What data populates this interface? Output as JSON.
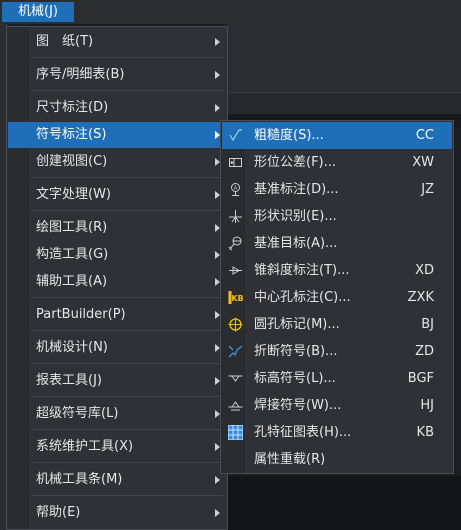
{
  "menubar": {
    "title": "机械(J)"
  },
  "menu": {
    "items": [
      {
        "label": "图　纸(T)",
        "arrow": true
      },
      {
        "label": "序号/明细表(B)",
        "arrow": true
      },
      {
        "label": "尺寸标注(D)",
        "arrow": true
      },
      {
        "label": "符号标注(S)",
        "arrow": true,
        "active": true
      },
      {
        "label": "创建视图(C)",
        "arrow": true
      },
      {
        "label": "文字处理(W)",
        "arrow": true
      },
      {
        "label": "绘图工具(R)",
        "arrow": true
      },
      {
        "label": "构造工具(G)",
        "arrow": true
      },
      {
        "label": "辅助工具(A)",
        "arrow": true
      },
      {
        "label": "PartBuilder(P)",
        "arrow": true
      },
      {
        "label": "机械设计(N)",
        "arrow": true
      },
      {
        "label": "报表工具(J)",
        "arrow": true
      },
      {
        "label": "超级符号库(L)",
        "arrow": true
      },
      {
        "label": "系统维护工具(X)",
        "arrow": true
      },
      {
        "label": "机械工具条(M)",
        "arrow": true
      },
      {
        "label": "帮助(E)",
        "arrow": true
      }
    ]
  },
  "submenu": {
    "items": [
      {
        "label": "粗糙度(S)...",
        "shortcut": "CC",
        "icon": "roughness-icon",
        "active": true
      },
      {
        "label": "形位公差(F)...",
        "shortcut": "XW",
        "icon": "tolerance-icon"
      },
      {
        "label": "基准标注(D)...",
        "shortcut": "JZ",
        "icon": "datum-icon"
      },
      {
        "label": "形状识别(E)...",
        "shortcut": "",
        "icon": "shape-recognition-icon"
      },
      {
        "label": "基准目标(A)...",
        "shortcut": "",
        "icon": "datum-target-icon"
      },
      {
        "label": "锥斜度标注(T)...",
        "shortcut": "XD",
        "icon": "taper-icon"
      },
      {
        "label": "中心孔标注(C)...",
        "shortcut": "ZXK",
        "icon": "center-hole-icon"
      },
      {
        "label": "圆孔标记(M)...",
        "shortcut": "BJ",
        "icon": "round-hole-icon"
      },
      {
        "label": "折断符号(B)...",
        "shortcut": "ZD",
        "icon": "break-symbol-icon"
      },
      {
        "label": "标高符号(L)...",
        "shortcut": "BGF",
        "icon": "elevation-icon"
      },
      {
        "label": "焊接符号(W)...",
        "shortcut": "HJ",
        "icon": "weld-icon"
      },
      {
        "label": "孔特征图表(H)...",
        "shortcut": "KB",
        "icon": "hole-table-icon"
      },
      {
        "label": "属性重载(R)",
        "shortcut": "",
        "icon": ""
      }
    ]
  }
}
